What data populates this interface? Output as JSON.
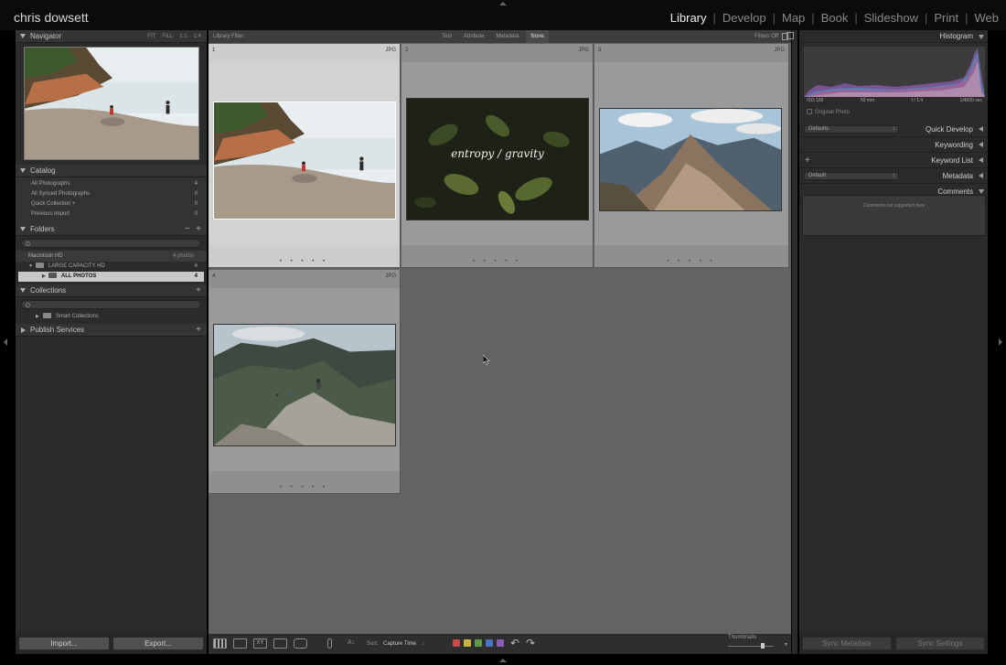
{
  "window": {
    "identity": "chris dowsett"
  },
  "modules": [
    "Library",
    "Develop",
    "Map",
    "Book",
    "Slideshow",
    "Print",
    "Web"
  ],
  "active_module": "Library",
  "navigator": {
    "title": "Navigator",
    "zoom_options": [
      "FIT",
      "FILL",
      "1:1",
      "1:4"
    ]
  },
  "catalog": {
    "title": "Catalog",
    "items": [
      {
        "label": "All Photographs",
        "count": "4"
      },
      {
        "label": "All Synced Photographs",
        "count": "0"
      },
      {
        "label": "Quick Collection +",
        "count": "0"
      },
      {
        "label": "Previous Import",
        "count": "0"
      }
    ]
  },
  "folders": {
    "title": "Folders",
    "volume": {
      "label": "Macintosh HD",
      "meta": "4 photos"
    },
    "items": [
      {
        "label": "LARGE CAPACITY HD",
        "count": "4"
      },
      {
        "label": "ALL PHOTOS",
        "count": "4"
      }
    ]
  },
  "collections": {
    "title": "Collections",
    "items": [
      {
        "label": "Smart Collections"
      }
    ]
  },
  "publish": {
    "title": "Publish Services"
  },
  "left_buttons": {
    "import": "Import...",
    "export": "Export..."
  },
  "filter": {
    "label": "Library Filter :",
    "tabs": [
      "Text",
      "Attribute",
      "Metadata",
      "None"
    ],
    "active": "None",
    "status": "Filters Off"
  },
  "grid": [
    {
      "index": "1",
      "ext": "JPG",
      "selected": true,
      "subject": "beach-children"
    },
    {
      "index": "2",
      "ext": "JPG",
      "selected": false,
      "subject": "leaves-title",
      "overlay": "entropy / gravity"
    },
    {
      "index": "3",
      "ext": "JPG",
      "selected": false,
      "subject": "mountain-peak"
    },
    {
      "index": "4",
      "ext": "JPG",
      "selected": false,
      "subject": "mountain-hikers"
    }
  ],
  "toolbar": {
    "sort_label": "Sort:",
    "sort_value": "Capture Time",
    "thumb_label": "Thumbnails"
  },
  "colors": {
    "label_red": "#c64a4a",
    "label_yellow": "#c9b343",
    "label_green": "#5c9a4a",
    "label_blue": "#4a73c2",
    "label_purple": "#8a5cb8"
  },
  "histogram": {
    "title": "Histogram",
    "iso": "ISO 100",
    "focal": "50 mm",
    "aperture": "f / 1.4",
    "shutter": "1/4000 sec",
    "original_photo": "Original Photo"
  },
  "quick_develop": {
    "title": "Quick Develop",
    "preset": "Defaults"
  },
  "keywording": {
    "title": "Keywording"
  },
  "keyword_list": {
    "title": "Keyword List"
  },
  "metadata": {
    "title": "Metadata",
    "preset": "Default"
  },
  "comments": {
    "title": "Comments",
    "note": "Comments not supported here"
  },
  "right_buttons": {
    "sync_metadata": "Sync Metadata",
    "sync_settings": "Sync Settings"
  }
}
